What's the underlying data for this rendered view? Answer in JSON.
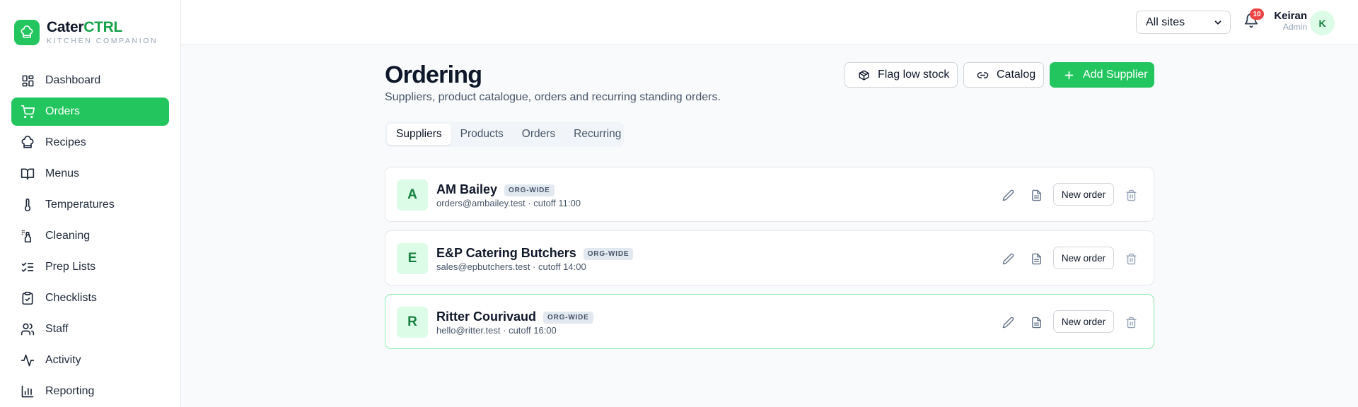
{
  "brand": {
    "name_part1": "Cater",
    "name_part2": "CTRL",
    "tagline": "KITCHEN COMPANION",
    "logo_icon": "chef-hat-icon",
    "accent_color": "#22c55e"
  },
  "sidebar": {
    "items": [
      {
        "label": "Dashboard",
        "icon": "layout-grid-icon",
        "active": false
      },
      {
        "label": "Orders",
        "icon": "shopping-cart-icon",
        "active": true
      },
      {
        "label": "Recipes",
        "icon": "chef-hat-icon",
        "active": false
      },
      {
        "label": "Menus",
        "icon": "book-open-icon",
        "active": false
      },
      {
        "label": "Temperatures",
        "icon": "thermometer-icon",
        "active": false
      },
      {
        "label": "Cleaning",
        "icon": "spray-bottle-icon",
        "active": false
      },
      {
        "label": "Prep Lists",
        "icon": "list-checks-icon",
        "active": false
      },
      {
        "label": "Checklists",
        "icon": "clipboard-check-icon",
        "active": false
      },
      {
        "label": "Staff",
        "icon": "users-icon",
        "active": false
      },
      {
        "label": "Activity",
        "icon": "activity-icon",
        "active": false
      },
      {
        "label": "Reporting",
        "icon": "bar-chart-icon",
        "active": false
      }
    ]
  },
  "topbar": {
    "site_select": {
      "value": "All sites"
    },
    "notifications": {
      "count": "10"
    },
    "user": {
      "name": "Keiran",
      "role": "Admin",
      "initial": "K"
    }
  },
  "page": {
    "title": "Ordering",
    "subtitle": "Suppliers, product catalogue, orders and recurring standing orders.",
    "actions": {
      "flag_low_stock": "Flag low stock",
      "catalog": "Catalog",
      "add_supplier": "Add Supplier"
    },
    "tabs": [
      {
        "label": "Suppliers",
        "active": true
      },
      {
        "label": "Products",
        "active": false
      },
      {
        "label": "Orders",
        "active": false
      },
      {
        "label": "Recurring",
        "active": false
      }
    ]
  },
  "suppliers": [
    {
      "initial": "A",
      "name": "AM Bailey",
      "badge": "ORG-WIDE",
      "meta": "orders@ambailey.test · cutoff 11:00",
      "new_order_label": "New order"
    },
    {
      "initial": "E",
      "name": "E&P Catering Butchers",
      "badge": "ORG-WIDE",
      "meta": "sales@epbutchers.test · cutoff 14:00",
      "new_order_label": "New order"
    },
    {
      "initial": "R",
      "name": "Ritter Courivaud",
      "badge": "ORG-WIDE",
      "meta": "hello@ritter.test · cutoff 16:00",
      "new_order_label": "New order"
    }
  ]
}
